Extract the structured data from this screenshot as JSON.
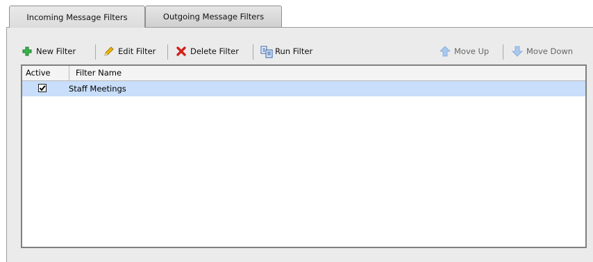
{
  "tabs": [
    {
      "label": "Incoming Message Filters",
      "active": true
    },
    {
      "label": "Outgoing Message Filters",
      "active": false
    }
  ],
  "toolbar": {
    "new_filter": "New Filter",
    "edit_filter": "Edit Filter",
    "delete_filter": "Delete Filter",
    "run_filter": "Run Filter",
    "move_up": "Move Up",
    "move_down": "Move Down"
  },
  "table": {
    "columns": [
      "Active",
      "Filter Name"
    ],
    "rows": [
      {
        "active": true,
        "name": "Staff Meetings"
      }
    ]
  },
  "colors": {
    "selected_row": "#c8defa",
    "panel_bg": "#ebebeb"
  }
}
